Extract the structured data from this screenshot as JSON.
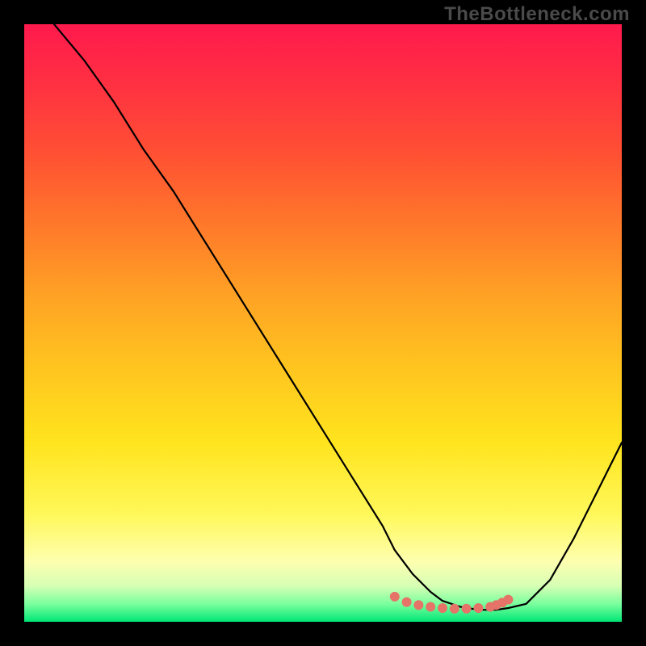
{
  "watermark": "TheBottleneck.com",
  "chart_data": {
    "type": "line",
    "title": "",
    "xlabel": "",
    "ylabel": "",
    "xlim": [
      0,
      100
    ],
    "ylim": [
      0,
      100
    ],
    "series": [
      {
        "name": "curve",
        "note": "Approximate bottleneck-curve. y-axis inverted (0 at bottom). Values estimated from pixel positions; no axis labels present in source image.",
        "color": "#000000",
        "x": [
          5,
          10,
          15,
          20,
          25,
          30,
          35,
          40,
          45,
          50,
          55,
          60,
          62,
          65,
          68,
          70,
          73,
          76,
          79,
          81,
          84,
          88,
          92,
          96,
          100
        ],
        "y": [
          100,
          94,
          87,
          79,
          72,
          64,
          56,
          48,
          40,
          32,
          24,
          16,
          12,
          8,
          5,
          3.5,
          2.5,
          2,
          2,
          2.3,
          3,
          7,
          14,
          22,
          30
        ]
      }
    ],
    "markers": {
      "name": "highlight-dots",
      "color": "#e57368",
      "note": "Small salmon dots along valley bottom",
      "x": [
        62,
        64,
        66,
        68,
        70,
        72,
        74,
        76,
        78,
        79,
        80,
        81
      ],
      "y": [
        4.2,
        3.3,
        2.8,
        2.5,
        2.3,
        2.2,
        2.2,
        2.3,
        2.5,
        2.8,
        3.2,
        3.7
      ]
    },
    "background_gradient": {
      "top_color": "#ff1a4d",
      "mid_color": "#ffe41e",
      "bottom_color": "#00e676"
    }
  }
}
